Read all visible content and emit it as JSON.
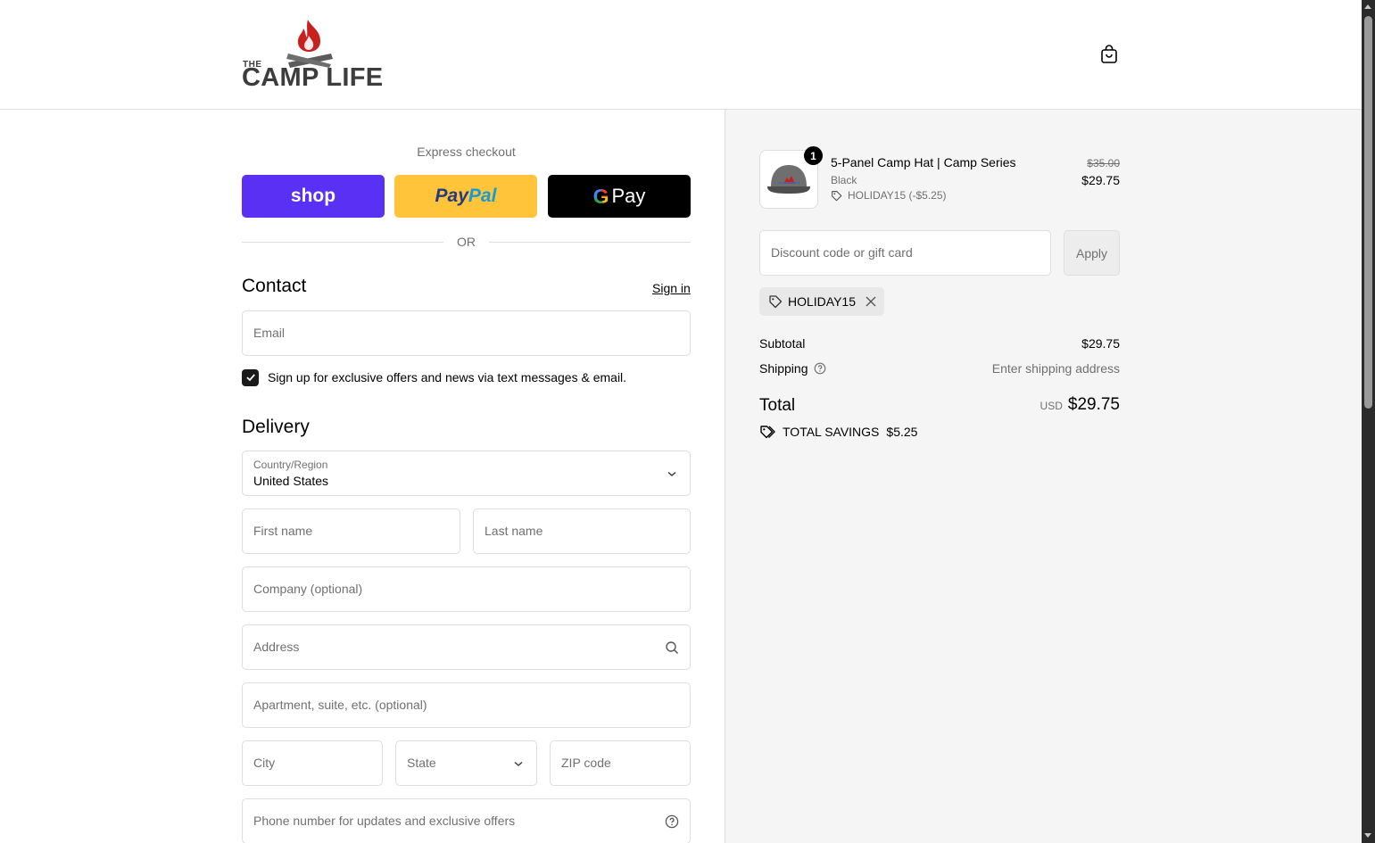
{
  "brand": {
    "the": "THE",
    "name": "CAMP LIFE"
  },
  "express": {
    "title": "Express checkout",
    "shop_label": "shop",
    "paypal_pay": "Pay",
    "paypal_pal": "Pal",
    "gpay_g": "G",
    "gpay_label": "Pay",
    "or_label": "OR"
  },
  "contact": {
    "title": "Contact",
    "sign_in": "Sign in",
    "email_placeholder": "Email",
    "marketing_label": "Sign up for exclusive offers and news via text messages & email.",
    "marketing_checked": true
  },
  "delivery": {
    "title": "Delivery",
    "country_label": "Country/Region",
    "country_value": "United States",
    "first_name": "First name",
    "last_name": "Last name",
    "company": "Company (optional)",
    "address": "Address",
    "apartment": "Apartment, suite, etc. (optional)",
    "city": "City",
    "state": "State",
    "zip": "ZIP code",
    "phone": "Phone number for updates and exclusive offers"
  },
  "order": {
    "item": {
      "quantity": "1",
      "name": "5-Panel Camp Hat | Camp Series",
      "variant": "Black",
      "discount": "HOLIDAY15 (-$5.25)",
      "original_price": "$35.00",
      "price": "$29.75"
    },
    "discount_placeholder": "Discount code or gift card",
    "apply_label": "Apply",
    "applied_code": "HOLIDAY15",
    "subtotal_label": "Subtotal",
    "subtotal_value": "$29.75",
    "shipping_label": "Shipping",
    "shipping_value": "Enter shipping address",
    "total_label": "Total",
    "currency": "USD",
    "total_value": "$29.75",
    "savings_label": "TOTAL SAVINGS",
    "savings_value": "$5.25"
  },
  "colors": {
    "shop": "#5a31f4",
    "paypal": "#ffc439",
    "gpay": "#000000",
    "flame": "#c8201e",
    "summary_bg": "#f5f5f5"
  }
}
